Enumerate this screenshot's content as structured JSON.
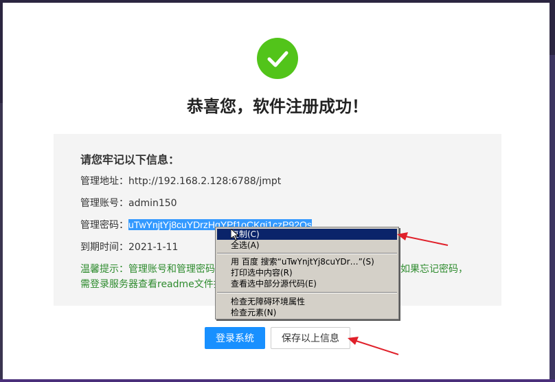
{
  "modal": {
    "title": "恭喜您，软件注册成功！",
    "success_icon": "check-icon",
    "info": {
      "heading": "请您牢记以下信息：",
      "address_label": "管理地址：",
      "address_value": "http://192.168.2.128:6788/jmpt",
      "account_label": "管理账号：",
      "account_value": "admin150",
      "password_label": "管理密码：",
      "password_value": "uTwYnjtYj8cuYDrzHqYPf1oCKqi1czP92Qs",
      "expire_label": "到期时间：",
      "expire_value": "2021-1-11",
      "tip_line1_start": "温馨提示：管理账号和管理密码",
      "tip_line1_end": "如果忘记密码，",
      "tip_line2": "需登录服务器查看readme文件找"
    },
    "buttons": {
      "login": "登录系统",
      "save": "保存以上信息"
    }
  },
  "context_menu": {
    "items": [
      {
        "label": "复制(C)",
        "highlighted": true
      },
      {
        "label": "全选(A)"
      },
      {
        "label": "用 百度 搜索“uTwYnjtYj8cuYDr…”(S)"
      },
      {
        "label": "打印选中内容(R)"
      },
      {
        "label": "查看选中部分源代码(E)"
      },
      {
        "label": "检查无障碍环境属性"
      },
      {
        "label": "检查元素(N)"
      }
    ]
  },
  "colors": {
    "accent": "#1890ff",
    "success": "#52c41a",
    "tip": "#2e8b2e",
    "selection": "#3399ff",
    "annotation_arrow": "#e0202a"
  }
}
